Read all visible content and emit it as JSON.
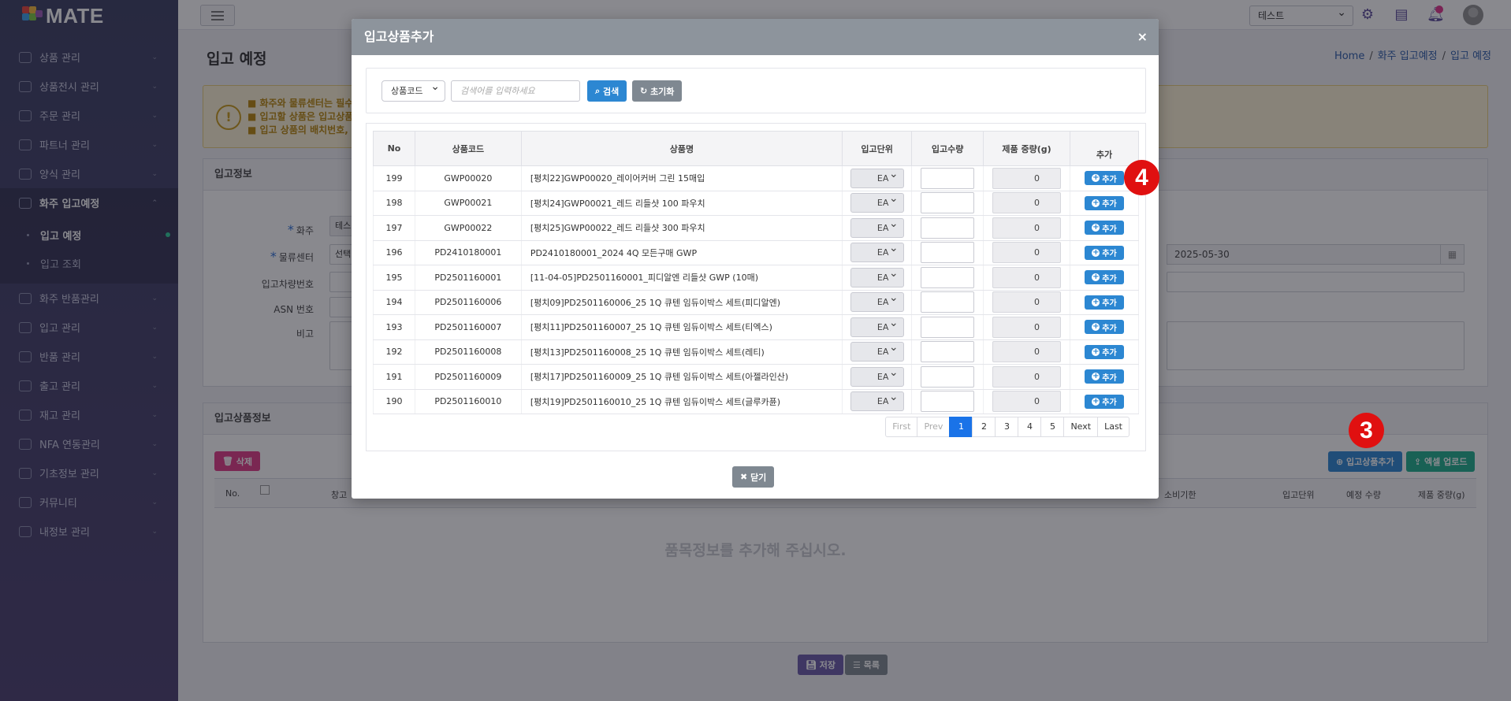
{
  "app": {
    "logo": "MATE"
  },
  "sidebar": {
    "items": [
      {
        "label": "상품 관리"
      },
      {
        "label": "상품전시 관리"
      },
      {
        "label": "주문 관리"
      },
      {
        "label": "파트너 관리"
      },
      {
        "label": "양식 관리"
      },
      {
        "label": "화주 입고예정"
      }
    ],
    "sub_items": [
      {
        "label": "입고 예정"
      },
      {
        "label": "입고 조회"
      }
    ],
    "items_after": [
      {
        "label": "화주 반품관리"
      },
      {
        "label": "입고 관리"
      },
      {
        "label": "반품 관리"
      },
      {
        "label": "출고 관리"
      },
      {
        "label": "재고 관리"
      },
      {
        "label": "NFA 연동관리"
      },
      {
        "label": "기초정보 관리"
      },
      {
        "label": "커뮤니티"
      },
      {
        "label": "내정보 관리"
      }
    ]
  },
  "topbar": {
    "company_select": "테스트"
  },
  "page": {
    "title": "입고 예정",
    "breadcrumb": [
      "Home",
      "화주 입고예정",
      "입고 예정"
    ],
    "notice_lines": [
      "■ 화주와 물류센터는 필수 입",
      "■ 입고할 상품은 입고상품 정",
      "■ 입고 상품의 배치번호, 로트"
    ],
    "info_panel": {
      "title": "입고정보",
      "labels": {
        "owner": "화주",
        "center": "물류센터",
        "vehicle": "입고차량번호",
        "asn": "ASN 번호",
        "memo": "비고"
      },
      "owner_value": "테스",
      "center_value": "선택",
      "date_value": "2025-05-30"
    },
    "product_panel": {
      "title": "입고상품정보",
      "delete_button": "삭제",
      "add_button": "입고상품추가",
      "excel_button": "엑셀 업로드",
      "columns": {
        "no": "No.",
        "warehouse": "창고",
        "expiry": "소비기한",
        "unit": "입고단위",
        "planned_qty": "예정 수량",
        "weight": "제품 중량(g)"
      },
      "empty_message": "품목정보를 추가해 주십시오."
    },
    "save_button": "저장",
    "list_button": "목록"
  },
  "modal": {
    "title": "입고상품추가",
    "close_x": "×",
    "search": {
      "field_select": "상품코드",
      "placeholder": "검색어를 입력하세요",
      "search_button": "검색",
      "reset_button": "초기화"
    },
    "columns": {
      "no": "No",
      "code": "상품코드",
      "name": "상품명",
      "unit": "입고단위",
      "qty": "입고수량",
      "weight": "제품 중량(g)",
      "add": "추가"
    },
    "rows": [
      {
        "no": "199",
        "code": "GWP00020",
        "name": "[평치22]GWP00020_레이어커버 그린 15매입",
        "unit": "EA",
        "weight": "0",
        "add": "추가"
      },
      {
        "no": "198",
        "code": "GWP00021",
        "name": "[평치24]GWP00021_레드 리들샷 100 파우치",
        "unit": "EA",
        "weight": "0",
        "add": "추가"
      },
      {
        "no": "197",
        "code": "GWP00022",
        "name": "[평치25]GWP00022_레드 리들샷 300 파우치",
        "unit": "EA",
        "weight": "0",
        "add": "추가"
      },
      {
        "no": "196",
        "code": "PD2410180001",
        "name": "PD2410180001_2024 4Q 모든구매 GWP",
        "unit": "EA",
        "weight": "0",
        "add": "추가"
      },
      {
        "no": "195",
        "code": "PD2501160001",
        "name": "[11-04-05]PD2501160001_피디알엔 리들샷 GWP (10매)",
        "unit": "EA",
        "weight": "0",
        "add": "추가"
      },
      {
        "no": "194",
        "code": "PD2501160006",
        "name": "[평치09]PD2501160006_25 1Q 큐텐 임듀이박스 세트(피디알엔)",
        "unit": "EA",
        "weight": "0",
        "add": "추가"
      },
      {
        "no": "193",
        "code": "PD2501160007",
        "name": "[평치11]PD2501160007_25 1Q 큐텐 임듀이박스 세트(티엑스)",
        "unit": "EA",
        "weight": "0",
        "add": "추가"
      },
      {
        "no": "192",
        "code": "PD2501160008",
        "name": "[평치13]PD2501160008_25 1Q 큐텐 임듀이박스 세트(레티)",
        "unit": "EA",
        "weight": "0",
        "add": "추가"
      },
      {
        "no": "191",
        "code": "PD2501160009",
        "name": "[평치17]PD2501160009_25 1Q 큐텐 임듀이박스 세트(아젤라인산)",
        "unit": "EA",
        "weight": "0",
        "add": "추가"
      },
      {
        "no": "190",
        "code": "PD2501160010",
        "name": "[평치19]PD2501160010_25 1Q 큐텐 임듀이박스 세트(글루카퓬)",
        "unit": "EA",
        "weight": "0",
        "add": "추가"
      }
    ],
    "pagination": {
      "first": "First",
      "prev": "Prev",
      "pages": [
        "1",
        "2",
        "3",
        "4",
        "5"
      ],
      "current": "1",
      "next": "Next",
      "last": "Last"
    },
    "close_button": "닫기"
  },
  "annotations": {
    "step3": "3",
    "step4": "4"
  },
  "colors": {
    "primary_blue": "#2c87d2",
    "teal": "#1fae8d",
    "pink": "#e03a86",
    "badge_red": "#e01010",
    "sidebar": "#3b3f63"
  }
}
